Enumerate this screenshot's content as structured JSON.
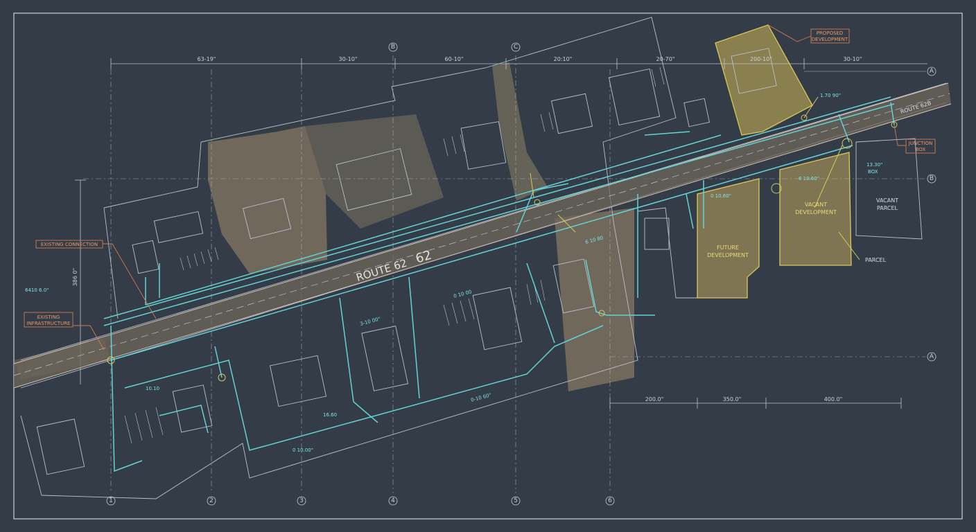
{
  "title_block": {},
  "road": {
    "name": "ROUTE 62",
    "number": "62",
    "label_right": "ROUTE 62B"
  },
  "dimensions": {
    "top": [
      "63-19\"",
      "30-10\"",
      "60-10\"",
      "20:10\"",
      "20-70\"",
      "200-10\"",
      "30-10\""
    ],
    "bottom": [
      "200.0\"",
      "350.0\"",
      "400.0\""
    ],
    "left": "386 0\""
  },
  "grid": {
    "bottom": [
      "1",
      "2",
      "3",
      "4",
      "5",
      "6"
    ],
    "top": [
      "B",
      "C"
    ],
    "right": [
      "A",
      "B",
      "A"
    ]
  },
  "callouts": {
    "existing_connection": "EXISTING CONNECTION",
    "existing_infrastructure": [
      "EXISTING",
      "INFRASTRUCTURE"
    ],
    "proposed_development": [
      "PROPOSED",
      "DEVELOPMENT"
    ],
    "junction_box": [
      "JUNCTION",
      "BOX"
    ]
  },
  "areas": {
    "vacant": [
      "VACANT",
      "DEVELOPMENT"
    ],
    "future": [
      "FUTURE",
      "DEVELOPMENT"
    ],
    "vacant_parcel": [
      "VACANT",
      "PARCEL"
    ],
    "parcel_label": "PARCEL"
  },
  "utility_labels": {
    "left_cyan": "6410 6.0\"",
    "bend_1": "10.10",
    "bottom_1": "16.60",
    "bottom_2": "0 10.00\"",
    "mid_1": "3-10 00\"",
    "mid_2": "0-10 60\"",
    "mid_3": "0 10 00",
    "mid_4": "6 10 80",
    "top_1": "1.70 90\"",
    "right_1": "13.30\"",
    "right_box": "BOX",
    "right_2": "6 10.60\"",
    "right_3": "0 10.60\""
  },
  "colors": {
    "background": "#343c47",
    "line": "#b9c2cc",
    "utility": "#63d3d6",
    "highlight": "#d8c95b",
    "callout": "#d07b4f",
    "parcel": "#7a705f"
  }
}
